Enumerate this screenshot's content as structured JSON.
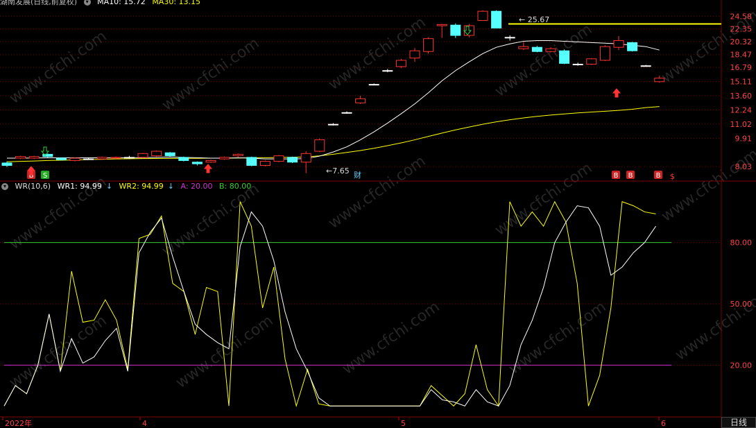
{
  "window": {
    "title": "湖南发展(日线,前复权)",
    "ma1_label": "MA10: 15.72",
    "ma2_label": "MA30: 13.15",
    "corner_mark": "✓"
  },
  "indicator": {
    "name": "WR(10,6)",
    "wr1_label": "WR1: 94.99",
    "wr2_label": "WR2: 94.99",
    "a_label": "A: 20.00",
    "b_label": "B: 80.00",
    "wr1_arrow": "↓",
    "wr2_arrow": "↓",
    "colors": {
      "wr1": "#ffffff",
      "wr2": "#ffff00",
      "a": "#cc33cc",
      "b": "#33cc33"
    }
  },
  "price_axis": [
    "24.58",
    "22.35",
    "20.32",
    "18.47",
    "16.79",
    "15.11",
    "13.60",
    "12.24",
    "11.02",
    "9.91",
    "8.03"
  ],
  "ind_axis": [
    "80.00",
    "50.00",
    "20.00"
  ],
  "time_axis": [
    "2022年",
    "4",
    "5",
    "6"
  ],
  "period_tab": "日线",
  "annotations": {
    "high": "25.67",
    "low": "7.65",
    "fin": "财"
  },
  "markers": {
    "buy": "B",
    "sell": "S"
  },
  "watermark": "www.cfchi.com",
  "colors": {
    "up": "#ff3333",
    "down": "#55ffff",
    "ma10": "#ffffff",
    "ma30": "#ffff00",
    "grid": "#800000",
    "flat": "#ffffff"
  },
  "chart_data": {
    "type": "candlestick",
    "candles": [
      {
        "o": 8.25,
        "c": 8.1,
        "h": 8.35,
        "l": 8.0
      },
      {
        "o": 8.55,
        "c": 8.65,
        "h": 8.7,
        "l": 8.5
      },
      {
        "o": 8.55,
        "c": 8.65,
        "h": 8.7,
        "l": 8.5
      },
      {
        "o": 8.8,
        "c": 8.65,
        "h": 8.85,
        "l": 8.6
      },
      {
        "o": 8.55,
        "c": 8.45,
        "h": 8.6,
        "l": 8.4
      },
      {
        "o": 8.4,
        "c": 8.55,
        "h": 8.6,
        "l": 8.35
      },
      {
        "o": 8.5,
        "c": 8.5,
        "h": 8.55,
        "l": 8.45
      },
      {
        "o": 8.5,
        "c": 8.6,
        "h": 8.65,
        "l": 8.45
      },
      {
        "o": 8.55,
        "c": 8.6,
        "h": 8.65,
        "l": 8.5
      },
      {
        "o": 8.6,
        "c": 8.6,
        "h": 8.7,
        "l": 8.5
      },
      {
        "o": 8.6,
        "c": 8.85,
        "h": 8.9,
        "l": 8.55
      },
      {
        "o": 8.7,
        "c": 9.0,
        "h": 9.05,
        "l": 8.65
      },
      {
        "o": 8.9,
        "c": 8.7,
        "h": 8.95,
        "l": 8.65
      },
      {
        "o": 8.6,
        "c": 8.4,
        "h": 8.65,
        "l": 8.35
      },
      {
        "o": 8.3,
        "c": 8.2,
        "h": 8.35,
        "l": 8.1
      },
      {
        "o": 8.3,
        "c": 8.4,
        "h": 8.45,
        "l": 8.25
      },
      {
        "o": 8.5,
        "c": 8.6,
        "h": 8.65,
        "l": 8.45
      },
      {
        "o": 8.7,
        "c": 8.8,
        "h": 8.85,
        "l": 8.6
      },
      {
        "o": 8.6,
        "c": 8.1,
        "h": 8.65,
        "l": 8.05
      },
      {
        "o": 8.1,
        "c": 8.35,
        "h": 8.4,
        "l": 8.05
      },
      {
        "o": 8.35,
        "c": 8.7,
        "h": 8.75,
        "l": 8.3
      },
      {
        "o": 8.6,
        "c": 8.3,
        "h": 8.65,
        "l": 8.25
      },
      {
        "o": 8.3,
        "c": 8.85,
        "h": 9.0,
        "l": 7.65
      },
      {
        "o": 9.0,
        "c": 9.8,
        "h": 9.9,
        "l": 8.95
      },
      {
        "o": 11.0,
        "c": 11.0,
        "h": 11.1,
        "l": 10.9
      },
      {
        "o": 12.0,
        "c": 12.0,
        "h": 12.1,
        "l": 11.9
      },
      {
        "o": 12.9,
        "c": 13.3,
        "h": 13.6,
        "l": 12.8
      },
      {
        "o": 14.8,
        "c": 14.8,
        "h": 14.9,
        "l": 14.7
      },
      {
        "o": 16.4,
        "c": 16.4,
        "h": 16.6,
        "l": 16.2
      },
      {
        "o": 16.9,
        "c": 17.7,
        "h": 17.9,
        "l": 16.7
      },
      {
        "o": 18.0,
        "c": 19.0,
        "h": 19.4,
        "l": 17.5
      },
      {
        "o": 18.9,
        "c": 20.8,
        "h": 21.0,
        "l": 18.6
      },
      {
        "o": 22.9,
        "c": 23.1,
        "h": 23.2,
        "l": 20.9
      },
      {
        "o": 23.0,
        "c": 21.3,
        "h": 23.3,
        "l": 20.9
      },
      {
        "o": 21.3,
        "c": 22.9,
        "h": 23.2,
        "l": 21.0
      },
      {
        "o": 23.8,
        "c": 25.5,
        "h": 25.67,
        "l": 23.8
      },
      {
        "o": 25.5,
        "c": 22.5,
        "h": 25.67,
        "l": 22.5
      },
      {
        "o": 21.0,
        "c": 21.0,
        "h": 21.3,
        "l": 20.5
      },
      {
        "o": 19.3,
        "c": 19.6,
        "h": 20.3,
        "l": 19.1
      },
      {
        "o": 19.5,
        "c": 18.9,
        "h": 19.7,
        "l": 18.8
      },
      {
        "o": 18.9,
        "c": 19.3,
        "h": 19.5,
        "l": 18.8
      },
      {
        "o": 19.0,
        "c": 17.3,
        "h": 19.2,
        "l": 17.2
      },
      {
        "o": 17.2,
        "c": 17.2,
        "h": 17.4,
        "l": 17.0
      },
      {
        "o": 17.2,
        "c": 17.9,
        "h": 18.0,
        "l": 17.1
      },
      {
        "o": 17.7,
        "c": 19.6,
        "h": 19.8,
        "l": 17.6
      },
      {
        "o": 19.5,
        "c": 20.5,
        "h": 21.2,
        "l": 19.1
      },
      {
        "o": 20.2,
        "c": 19.0,
        "h": 20.3,
        "l": 18.9
      },
      {
        "o": 17.0,
        "c": 17.0,
        "h": 17.1,
        "l": 16.9
      },
      {
        "o": 15.1,
        "c": 15.5,
        "h": 15.8,
        "l": 15.0
      }
    ],
    "ma10": [
      8.55,
      8.55,
      8.56,
      8.57,
      8.57,
      8.57,
      8.57,
      8.57,
      8.58,
      8.58,
      8.58,
      8.6,
      8.62,
      8.6,
      8.58,
      8.55,
      8.55,
      8.57,
      8.55,
      8.5,
      8.5,
      8.5,
      8.52,
      8.68,
      8.95,
      9.3,
      9.8,
      10.4,
      11.1,
      11.9,
      12.8,
      13.9,
      15.2,
      16.4,
      17.5,
      18.6,
      19.5,
      20.0,
      20.4,
      20.5,
      20.5,
      20.4,
      20.3,
      20.2,
      20.1,
      20.0,
      19.8,
      19.6,
      19.1
    ],
    "ma30": [
      8.32,
      8.35,
      8.37,
      8.4,
      8.42,
      8.44,
      8.46,
      8.48,
      8.5,
      8.51,
      8.52,
      8.53,
      8.53,
      8.54,
      8.54,
      8.55,
      8.55,
      8.56,
      8.57,
      8.58,
      8.59,
      8.61,
      8.63,
      8.7,
      8.8,
      8.92,
      9.05,
      9.2,
      9.38,
      9.58,
      9.8,
      10.05,
      10.3,
      10.55,
      10.78,
      11.0,
      11.2,
      11.38,
      11.53,
      11.67,
      11.78,
      11.88,
      11.97,
      12.05,
      12.12,
      12.2,
      12.3,
      12.45,
      12.55
    ],
    "ylim": [
      7.4,
      26.6
    ],
    "indicator": {
      "wr1": [
        0,
        10,
        6,
        20,
        45,
        17,
        33,
        21,
        24,
        32,
        38,
        17,
        75,
        85,
        92,
        73,
        56,
        40,
        35,
        31,
        28,
        78,
        95,
        88,
        71,
        46,
        28,
        17,
        4,
        0,
        0,
        0,
        0,
        0,
        0,
        0,
        0,
        0,
        8,
        3,
        2,
        0,
        8,
        2,
        0,
        10,
        30,
        42,
        58,
        80,
        90,
        98,
        97,
        88,
        64,
        68,
        75,
        80,
        88
      ],
      "wr2": [
        0,
        10,
        6,
        20,
        45,
        17,
        66,
        41,
        42,
        52,
        42,
        18,
        82,
        84,
        93,
        60,
        56,
        35,
        58,
        56,
        0,
        100,
        88,
        48,
        68,
        23,
        0,
        18,
        1,
        0,
        0,
        0,
        0,
        0,
        0,
        0,
        0,
        0,
        10,
        5,
        0,
        6,
        30,
        8,
        0,
        100,
        88,
        95,
        88,
        100,
        90,
        60,
        0,
        15,
        48,
        100,
        98,
        95,
        94
      ],
      "a": 20,
      "b": 80,
      "ylim": [
        -5,
        105
      ]
    }
  }
}
